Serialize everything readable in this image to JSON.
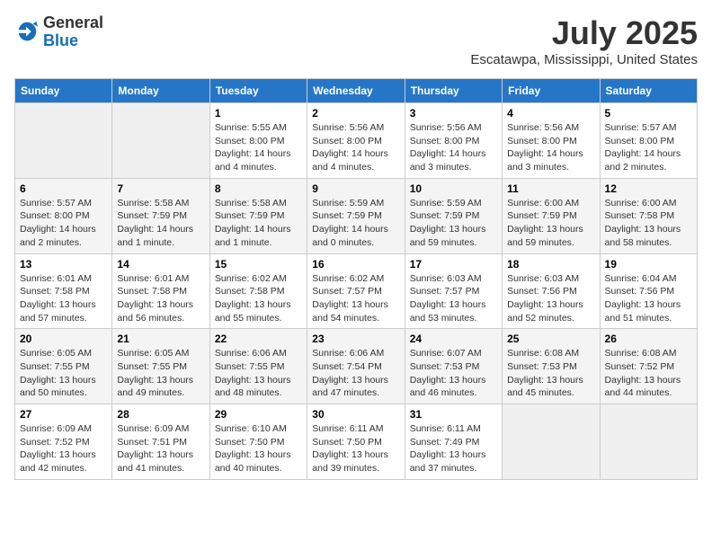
{
  "header": {
    "logo_general": "General",
    "logo_blue": "Blue",
    "month": "July 2025",
    "location": "Escatawpa, Mississippi, United States"
  },
  "weekdays": [
    "Sunday",
    "Monday",
    "Tuesday",
    "Wednesday",
    "Thursday",
    "Friday",
    "Saturday"
  ],
  "weeks": [
    [
      {
        "day": "",
        "info": ""
      },
      {
        "day": "",
        "info": ""
      },
      {
        "day": "1",
        "info": "Sunrise: 5:55 AM\nSunset: 8:00 PM\nDaylight: 14 hours and 4 minutes."
      },
      {
        "day": "2",
        "info": "Sunrise: 5:56 AM\nSunset: 8:00 PM\nDaylight: 14 hours and 4 minutes."
      },
      {
        "day": "3",
        "info": "Sunrise: 5:56 AM\nSunset: 8:00 PM\nDaylight: 14 hours and 3 minutes."
      },
      {
        "day": "4",
        "info": "Sunrise: 5:56 AM\nSunset: 8:00 PM\nDaylight: 14 hours and 3 minutes."
      },
      {
        "day": "5",
        "info": "Sunrise: 5:57 AM\nSunset: 8:00 PM\nDaylight: 14 hours and 2 minutes."
      }
    ],
    [
      {
        "day": "6",
        "info": "Sunrise: 5:57 AM\nSunset: 8:00 PM\nDaylight: 14 hours and 2 minutes."
      },
      {
        "day": "7",
        "info": "Sunrise: 5:58 AM\nSunset: 7:59 PM\nDaylight: 14 hours and 1 minute."
      },
      {
        "day": "8",
        "info": "Sunrise: 5:58 AM\nSunset: 7:59 PM\nDaylight: 14 hours and 1 minute."
      },
      {
        "day": "9",
        "info": "Sunrise: 5:59 AM\nSunset: 7:59 PM\nDaylight: 14 hours and 0 minutes."
      },
      {
        "day": "10",
        "info": "Sunrise: 5:59 AM\nSunset: 7:59 PM\nDaylight: 13 hours and 59 minutes."
      },
      {
        "day": "11",
        "info": "Sunrise: 6:00 AM\nSunset: 7:59 PM\nDaylight: 13 hours and 59 minutes."
      },
      {
        "day": "12",
        "info": "Sunrise: 6:00 AM\nSunset: 7:58 PM\nDaylight: 13 hours and 58 minutes."
      }
    ],
    [
      {
        "day": "13",
        "info": "Sunrise: 6:01 AM\nSunset: 7:58 PM\nDaylight: 13 hours and 57 minutes."
      },
      {
        "day": "14",
        "info": "Sunrise: 6:01 AM\nSunset: 7:58 PM\nDaylight: 13 hours and 56 minutes."
      },
      {
        "day": "15",
        "info": "Sunrise: 6:02 AM\nSunset: 7:58 PM\nDaylight: 13 hours and 55 minutes."
      },
      {
        "day": "16",
        "info": "Sunrise: 6:02 AM\nSunset: 7:57 PM\nDaylight: 13 hours and 54 minutes."
      },
      {
        "day": "17",
        "info": "Sunrise: 6:03 AM\nSunset: 7:57 PM\nDaylight: 13 hours and 53 minutes."
      },
      {
        "day": "18",
        "info": "Sunrise: 6:03 AM\nSunset: 7:56 PM\nDaylight: 13 hours and 52 minutes."
      },
      {
        "day": "19",
        "info": "Sunrise: 6:04 AM\nSunset: 7:56 PM\nDaylight: 13 hours and 51 minutes."
      }
    ],
    [
      {
        "day": "20",
        "info": "Sunrise: 6:05 AM\nSunset: 7:55 PM\nDaylight: 13 hours and 50 minutes."
      },
      {
        "day": "21",
        "info": "Sunrise: 6:05 AM\nSunset: 7:55 PM\nDaylight: 13 hours and 49 minutes."
      },
      {
        "day": "22",
        "info": "Sunrise: 6:06 AM\nSunset: 7:55 PM\nDaylight: 13 hours and 48 minutes."
      },
      {
        "day": "23",
        "info": "Sunrise: 6:06 AM\nSunset: 7:54 PM\nDaylight: 13 hours and 47 minutes."
      },
      {
        "day": "24",
        "info": "Sunrise: 6:07 AM\nSunset: 7:53 PM\nDaylight: 13 hours and 46 minutes."
      },
      {
        "day": "25",
        "info": "Sunrise: 6:08 AM\nSunset: 7:53 PM\nDaylight: 13 hours and 45 minutes."
      },
      {
        "day": "26",
        "info": "Sunrise: 6:08 AM\nSunset: 7:52 PM\nDaylight: 13 hours and 44 minutes."
      }
    ],
    [
      {
        "day": "27",
        "info": "Sunrise: 6:09 AM\nSunset: 7:52 PM\nDaylight: 13 hours and 42 minutes."
      },
      {
        "day": "28",
        "info": "Sunrise: 6:09 AM\nSunset: 7:51 PM\nDaylight: 13 hours and 41 minutes."
      },
      {
        "day": "29",
        "info": "Sunrise: 6:10 AM\nSunset: 7:50 PM\nDaylight: 13 hours and 40 minutes."
      },
      {
        "day": "30",
        "info": "Sunrise: 6:11 AM\nSunset: 7:50 PM\nDaylight: 13 hours and 39 minutes."
      },
      {
        "day": "31",
        "info": "Sunrise: 6:11 AM\nSunset: 7:49 PM\nDaylight: 13 hours and 37 minutes."
      },
      {
        "day": "",
        "info": ""
      },
      {
        "day": "",
        "info": ""
      }
    ]
  ]
}
